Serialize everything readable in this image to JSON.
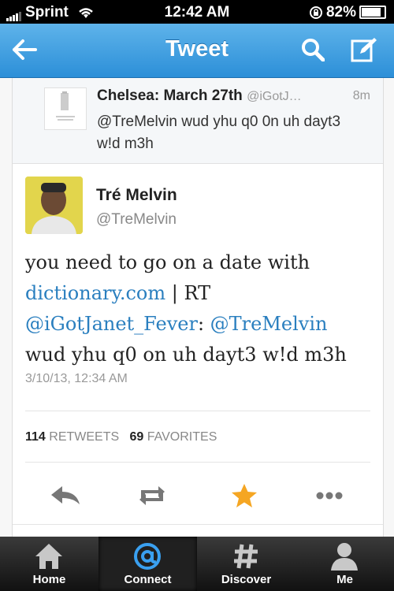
{
  "status_bar": {
    "carrier": "Sprint",
    "time": "12:42 AM",
    "battery": "82%"
  },
  "nav": {
    "title": "Tweet"
  },
  "reply": {
    "name": "Chelsea: March 27th",
    "handle": "@iGotJ…",
    "age": "8m",
    "text": "@TreMelvin wud yhu q0 0n uh dayt3 w!d m3h"
  },
  "tweet": {
    "author_name": "Tré Melvin",
    "author_handle": "@TreMelvin",
    "text_part1": "you need to go on a date with ",
    "link_text": "dictionary.com",
    "text_part2": " | RT ",
    "mention1": "@iGotJanet_Fever",
    "text_part3": ": ",
    "mention2": "@TreMelvin",
    "text_part4": " wud yhu q0 on uh dayt3 w!d m3h",
    "date": "3/10/13, 12:34 AM",
    "retweets_count": "114",
    "retweets_label": "RETWEETS",
    "favorites_count": "69",
    "favorites_label": "FAVORITES"
  },
  "tabs": [
    {
      "label": "Home",
      "icon": "home-icon"
    },
    {
      "label": "Connect",
      "icon": "at-icon"
    },
    {
      "label": "Discover",
      "icon": "hash-icon"
    },
    {
      "label": "Me",
      "icon": "person-icon"
    }
  ],
  "colors": {
    "nav": "#3a9be0",
    "link": "#2a7fbf",
    "favorite": "#f5a623"
  }
}
